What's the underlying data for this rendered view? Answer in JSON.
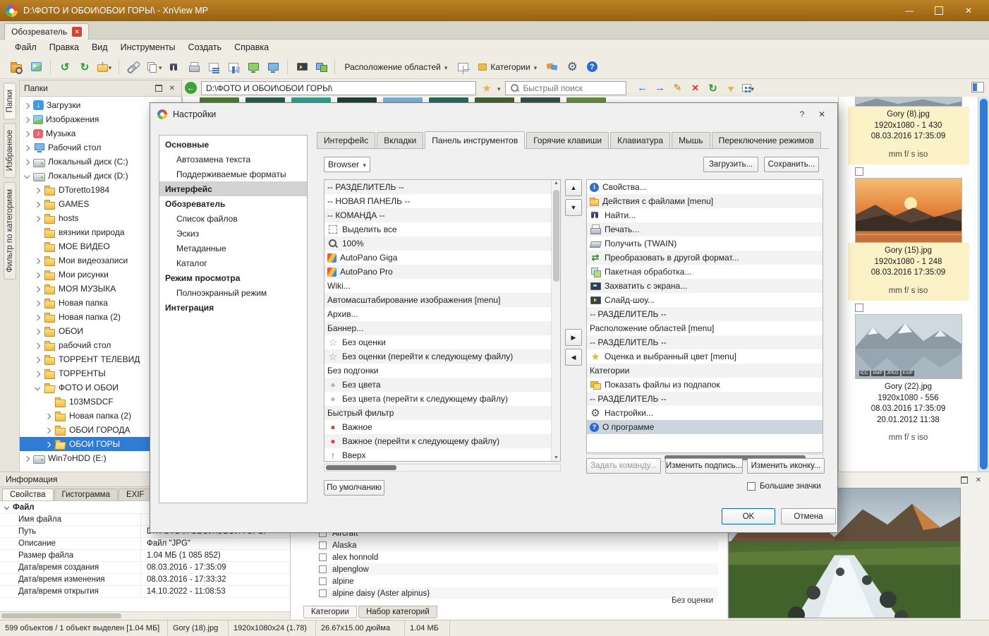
{
  "colors": {
    "titlebar": "#aa7012",
    "selection": "#2f7cd6",
    "thumb_selected_bg": "#fbf2c8",
    "scrollbar": "#2f7cd6"
  },
  "window": {
    "title": "D:\\ФОТО И ОБОИ\\ОБОИ ГОРЫ\\ - XnView MP"
  },
  "tabbar": {
    "tab_label": "Обозреватель"
  },
  "menubar": {
    "items": [
      "Файл",
      "Правка",
      "Вид",
      "Инструменты",
      "Создать",
      "Справка"
    ]
  },
  "toolbar": {
    "groups": [
      [
        "browse",
        "viewer"
      ],
      [
        "undo",
        "redo",
        "parent-folder"
      ],
      [
        "link",
        "copy",
        "find",
        "print",
        "layout-list",
        "layout-cols",
        "monitor-green",
        "monitor-blue"
      ],
      [
        "slideshow",
        "compare"
      ]
    ],
    "areas_label": "Расположение областей",
    "categories_label": "Категории",
    "tail_icons": [
      "category-pair",
      "settings-gear",
      "help"
    ]
  },
  "addressbar": {
    "path": "D:\\ФОТО И ОБОИ\\ОБОИ ГОРЫ\\",
    "search_placeholder": "Быстрый поиск",
    "right_icons": [
      "nav-back",
      "nav-forward",
      "edit",
      "delete",
      "refresh",
      "filter",
      "view-grid"
    ]
  },
  "background_strip": [
    "#4e7a3a",
    "#2e5d4e",
    "#3aa08e",
    "#223f38",
    "#7fb3d5",
    "#2d6a5f",
    "#49623a",
    "#35514a",
    "#6a8a4a"
  ],
  "sidebar": {
    "vertical_tabs": [
      "Папки",
      "Избранное",
      "Фильтр по категориям"
    ],
    "folders_header": "Папки",
    "tree": [
      {
        "label": "Загрузки",
        "icon": "download",
        "depth": 1,
        "arrow": ">"
      },
      {
        "label": "Изображения",
        "icon": "pictures",
        "depth": 1,
        "arrow": ">"
      },
      {
        "label": "Музыка",
        "icon": "music",
        "depth": 1,
        "arrow": ">"
      },
      {
        "label": "Рабочий стол",
        "icon": "desktop",
        "depth": 1,
        "arrow": ">"
      },
      {
        "label": "Локальный диск (C:)",
        "icon": "drive",
        "depth": 1,
        "arrow": ">"
      },
      {
        "label": "Локальный диск (D:)",
        "icon": "drive",
        "depth": 1,
        "arrow": "v"
      },
      {
        "label": "DToretto1984",
        "icon": "folder",
        "depth": 2,
        "arrow": ">"
      },
      {
        "label": "GAMES",
        "icon": "folder",
        "depth": 2,
        "arrow": ">"
      },
      {
        "label": "hosts",
        "icon": "folder",
        "depth": 2,
        "arrow": ">"
      },
      {
        "label": "вязники природа",
        "icon": "folder",
        "depth": 2,
        "arrow": ""
      },
      {
        "label": "МОЕ ВИДЕО",
        "icon": "folder",
        "depth": 2,
        "arrow": ""
      },
      {
        "label": "Мои видеозаписи",
        "icon": "folder",
        "depth": 2,
        "arrow": ">"
      },
      {
        "label": "Мои рисунки",
        "icon": "folder",
        "depth": 2,
        "arrow": ">"
      },
      {
        "label": "МОЯ МУЗЫКА",
        "icon": "folder",
        "depth": 2,
        "arrow": ">"
      },
      {
        "label": "Новая папка",
        "icon": "folder",
        "depth": 2,
        "arrow": ">"
      },
      {
        "label": "Новая папка (2)",
        "icon": "folder",
        "depth": 2,
        "arrow": ">"
      },
      {
        "label": "ОБОИ",
        "icon": "folder",
        "depth": 2,
        "arrow": ">"
      },
      {
        "label": "рабочий стол",
        "icon": "folder",
        "depth": 2,
        "arrow": ">"
      },
      {
        "label": "ТОРРЕНТ ТЕЛЕВИД",
        "icon": "folder",
        "depth": 2,
        "arrow": ">"
      },
      {
        "label": "ТОРРЕНТЫ",
        "icon": "folder",
        "depth": 2,
        "arrow": ">"
      },
      {
        "label": "ФОТО И ОБОИ",
        "icon": "folder-open",
        "depth": 2,
        "arrow": "v"
      },
      {
        "label": "103MSDCF",
        "icon": "folder",
        "depth": 3,
        "arrow": ""
      },
      {
        "label": "Новая папка (2)",
        "icon": "folder",
        "depth": 3,
        "arrow": ">"
      },
      {
        "label": "ОБОИ ГОРОДА",
        "icon": "folder",
        "depth": 3,
        "arrow": ">"
      },
      {
        "label": "ОБОИ ГОРЫ",
        "icon": "folder-open",
        "depth": 3,
        "arrow": ">",
        "selected": true
      },
      {
        "label": "Win7oHDD (E:)",
        "icon": "drive",
        "depth": 1,
        "arrow": ">"
      }
    ]
  },
  "dialog": {
    "title": "Настройки",
    "nav": [
      {
        "label": "Основные",
        "bold": true
      },
      {
        "label": "Автозамена текста",
        "indent": true
      },
      {
        "label": "Поддерживаемые форматы",
        "indent": true
      },
      {
        "label": "Интерфейс",
        "bold": true,
        "selected": true
      },
      {
        "label": "Обозреватель",
        "bold": true
      },
      {
        "label": "Список файлов",
        "indent": true
      },
      {
        "label": "Эскиз",
        "indent": true
      },
      {
        "label": "Метаданные",
        "indent": true
      },
      {
        "label": "Каталог",
        "indent": true
      },
      {
        "label": "Режим просмотра",
        "bold": true
      },
      {
        "label": "Полноэкранный режим",
        "indent": true
      },
      {
        "label": "Интеграция",
        "bold": true
      }
    ],
    "tabs": [
      "Интерфейс",
      "Вкладки",
      "Панель инструментов",
      "Горячие клавиши",
      "Клавиатура",
      "Мышь",
      "Переключение режимов"
    ],
    "active_tab_index": 2,
    "toolbar_target": "Browser",
    "load_button": "Загрузить...",
    "save_button": "Сохранить...",
    "available_commands": [
      {
        "label": "-- РАЗДЕЛИТЕЛЬ --"
      },
      {
        "label": "-- НОВАЯ ПАНЕЛЬ --"
      },
      {
        "label": "-- КОМАНДА --"
      },
      {
        "label": "Выделить все",
        "icon": "select-all"
      },
      {
        "label": "100%",
        "icon": "zoom-100"
      },
      {
        "label": "AutoPano Giga",
        "icon": "autopano"
      },
      {
        "label": "AutoPano Pro",
        "icon": "autopano"
      },
      {
        "label": "Wiki..."
      },
      {
        "label": "Автомасштабирование изображения [menu]"
      },
      {
        "label": "Архив..."
      },
      {
        "label": "Баннер..."
      },
      {
        "label": "Без оценки",
        "icon": "star-empty"
      },
      {
        "label": "Без оценки (перейти к следующему файлу)",
        "icon": "star-empty"
      },
      {
        "label": "Без подгонки"
      },
      {
        "label": "Без цвета",
        "icon": "circle-gray"
      },
      {
        "label": "Без цвета (перейти к следующему файлу)",
        "icon": "circle-gray"
      },
      {
        "label": "Быстрый фильтр"
      },
      {
        "label": "Важное",
        "icon": "circle-red"
      },
      {
        "label": "Важное (перейти к следующему файлу)",
        "icon": "circle-red"
      },
      {
        "label": "Вверх",
        "icon": "arrow-up-green"
      }
    ],
    "current_commands": [
      {
        "label": "Свойства...",
        "icon": "properties"
      },
      {
        "label": "Действия с файлами [menu]",
        "icon": "file-actions"
      },
      {
        "label": "Найти...",
        "icon": "find"
      },
      {
        "label": "Печать...",
        "icon": "print"
      },
      {
        "label": "Получить (TWAIN)",
        "icon": "twain"
      },
      {
        "label": "Преобразовать в другой формат...",
        "icon": "convert"
      },
      {
        "label": "Пакетная обработка...",
        "icon": "batch"
      },
      {
        "label": "Захватить с экрана...",
        "icon": "capture"
      },
      {
        "label": "Слайд-шоу...",
        "icon": "slideshow"
      },
      {
        "label": "-- РАЗДЕЛИТЕЛЬ --"
      },
      {
        "label": "Расположение областей [menu]"
      },
      {
        "label": "-- РАЗДЕЛИТЕЛЬ --"
      },
      {
        "label": "Оценка и выбранный цвет [menu]",
        "icon": "rating"
      },
      {
        "label": "Категории"
      },
      {
        "label": "Показать файлы из подпапок",
        "icon": "subfolders"
      },
      {
        "label": "-- РАЗДЕЛИТЕЛЬ --"
      },
      {
        "label": "Настройки...",
        "icon": "settings"
      },
      {
        "label": "О программе",
        "icon": "about",
        "selected": true
      }
    ],
    "set_command_button": "Задать команду...",
    "edit_caption_button": "Изменить подпись...",
    "edit_icon_button": "Изменить иконку...",
    "big_icons_label": "Большие значки",
    "defaults_button": "По умолчанию",
    "ok_button": "OK",
    "cancel_button": "Отмена"
  },
  "thumbnails": {
    "items": [
      {
        "name": "Gory (8).jpg",
        "lines": [
          "1920x1080 - 1 430",
          "08.03.2016 17:35:09"
        ],
        "exif_line": "mm f/ s iso",
        "image": "strip",
        "selected": true,
        "partial": true
      },
      {
        "name": "Gory (15).jpg",
        "lines": [
          "1920x1080 - 1 248",
          "08.03.2016 17:35:09"
        ],
        "exif_line": "mm f/ s iso",
        "image": "sunset",
        "selected": true
      },
      {
        "name": "Gory (22).jpg",
        "lines": [
          "1920x1080 - 556",
          "08.03.2016 17:35:09",
          "20.01.2012 11:38"
        ],
        "exif_line": "mm f/ s iso",
        "image": "reflection",
        "badges": [
          "ICC",
          "XMP",
          "JPEG",
          "EXIF"
        ],
        "selected": false
      }
    ]
  },
  "info_panel": {
    "header": "Информация",
    "tabs": [
      "Свойства",
      "Гистограмма",
      "EXIF"
    ],
    "active_tab": "Свойства",
    "section": "Файл",
    "rows": [
      {
        "label": "Имя файла",
        "value": ""
      },
      {
        "label": "Путь",
        "value": "D:\\ФОТО И ОБОИ\\ОБОИ ГОРЫ"
      },
      {
        "label": "Описание",
        "value": "Файл \"JPG\""
      },
      {
        "label": "Размер файла",
        "value": "1.04 МБ (1 085 852)"
      },
      {
        "label": "Дата/время создания",
        "value": "08.03.2016 - 17:35:09"
      },
      {
        "label": "Дата/время изменения",
        "value": "08.03.2016 - 17:33:32"
      },
      {
        "label": "Дата/время открытия",
        "value": "14.10.2022 - 11:08:53"
      }
    ]
  },
  "categories_panel": {
    "items": [
      {
        "label": "Aircraft"
      },
      {
        "label": "Alaska"
      },
      {
        "label": "alex honnold"
      },
      {
        "label": "alpenglow"
      },
      {
        "label": "alpine"
      },
      {
        "label": "alpine daisy (Aster alpinus)"
      }
    ],
    "rating_text": "Без оценки",
    "tabs": [
      "Категории",
      "Набор категорий"
    ],
    "active_tab": "Категории"
  },
  "statusbar": {
    "segments": [
      "599 объектов / 1 объект выделен [1.04 МБ]",
      "Gory (18).jpg",
      "1920x1080x24 (1.78)",
      "26.67x15.00 дюйма",
      "1.04 МБ"
    ]
  }
}
